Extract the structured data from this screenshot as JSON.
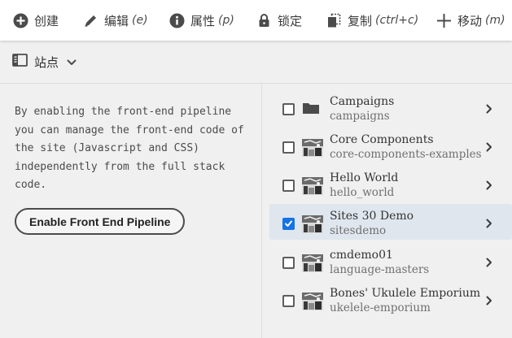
{
  "toolbar": {
    "create": {
      "label": "创建",
      "icon": "plus-circle-icon"
    },
    "edit": {
      "label": "编辑",
      "shortcut": "(e)",
      "icon": "pencil-icon"
    },
    "properties": {
      "label": "属性",
      "shortcut": "(p)",
      "icon": "info-icon"
    },
    "lock": {
      "label": "锁定",
      "icon": "lock-icon"
    },
    "copy": {
      "label": "复制",
      "shortcut": "(ctrl+c)",
      "icon": "copy-icon"
    },
    "move": {
      "label": "移动",
      "shortcut": "(m)",
      "icon": "move-icon"
    }
  },
  "subbar": {
    "rail_label": "站点",
    "rail_icon": "rail-panel-icon",
    "chevron_icon": "chevron-down-icon"
  },
  "left_panel": {
    "description": "By enabling the front-end pipeline you can manage the front-end code of the site (Javascript and CSS) independently from the full stack code.",
    "button_label": "Enable Front End Pipeline"
  },
  "sites": [
    {
      "title": "Campaigns",
      "name": "campaigns",
      "thumb": "folder-icon",
      "checked": false
    },
    {
      "title": "Core Components",
      "name": "core-components-examples",
      "thumb": "site-thumbnail",
      "checked": false
    },
    {
      "title": "Hello World",
      "name": "hello_world",
      "thumb": "site-thumbnail",
      "checked": false
    },
    {
      "title": "Sites 30 Demo",
      "name": "sitesdemo",
      "thumb": "site-thumbnail",
      "checked": true
    },
    {
      "title": "cmdemo01",
      "name": "language-masters",
      "thumb": "site-thumbnail",
      "checked": false
    },
    {
      "title": "Bones' Ukulele Emporium",
      "name": "ukelele-emporium",
      "thumb": "site-thumbnail",
      "checked": false
    }
  ],
  "colors": {
    "accent": "#1473e6",
    "selected_row": "#dfe6ee",
    "background": "#f0f0f0"
  }
}
